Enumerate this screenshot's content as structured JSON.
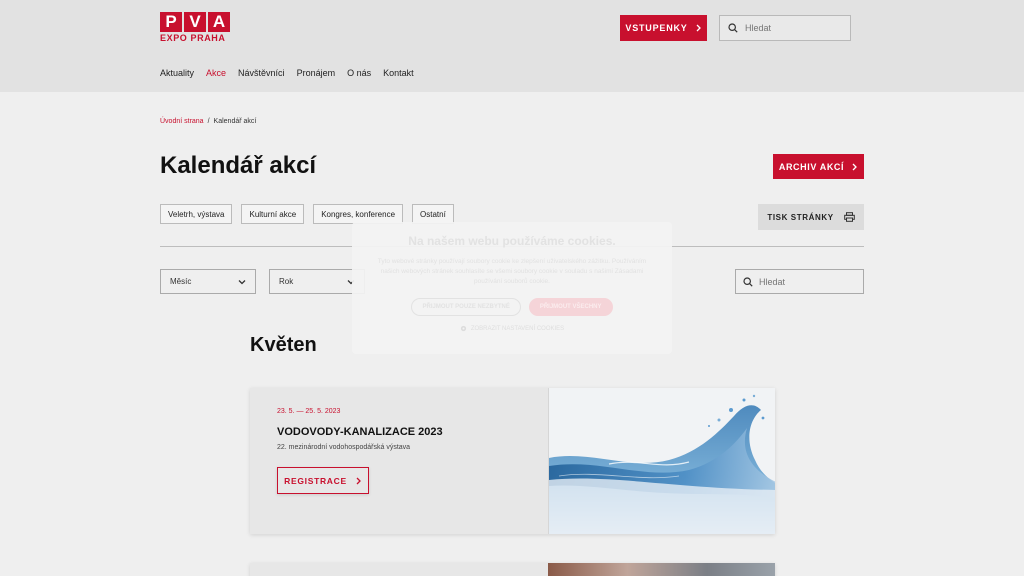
{
  "colors": {
    "brand": "#c8102e",
    "header_bg": "#e2e2e2",
    "page_bg": "#efefef"
  },
  "logo": {
    "letters": [
      "P",
      "V",
      "A"
    ],
    "subtitle": "EXPO PRAHA"
  },
  "header": {
    "tickets_label": "VSTUPENKY",
    "search_placeholder": "Hledat",
    "nav": [
      {
        "label": "Aktuality",
        "active": false
      },
      {
        "label": "Akce",
        "active": true
      },
      {
        "label": "Návštěvníci",
        "active": false
      },
      {
        "label": "Pronájem",
        "active": false
      },
      {
        "label": "O nás",
        "active": false
      },
      {
        "label": "Kontakt",
        "active": false
      }
    ]
  },
  "breadcrumb": {
    "home": "Úvodní strana",
    "separator": "/",
    "current": "Kalendář akcí"
  },
  "page": {
    "title": "Kalendář akcí",
    "archive_label": "ARCHIV AKCÍ",
    "print_label": "TISK STRÁNKY",
    "filters": [
      "Veletrh, výstava",
      "Kulturní akce",
      "Kongres, konference",
      "Ostatní"
    ],
    "month_select": "Měsíc",
    "year_select": "Rok",
    "search_placeholder": "Hledat",
    "month_heading": "Květen"
  },
  "events": [
    {
      "date": "23. 5. — 25. 5. 2023",
      "title": "VODOVODY-KANALIZACE 2023",
      "description": "22. mezinárodní vodohospodářská výstava",
      "register_label": "REGISTRACE"
    }
  ],
  "cookie": {
    "title": "Na našem webu používáme cookies.",
    "text": "Tyto webové stránky používají soubory cookie ke zlepšení uživatelského zážitku. Používáním našich webových stránek souhlasíte se všemi soubory cookie v souladu s našimi Zásadami používání souborů cookie.",
    "necessary_label": "PŘIJMOUT POUZE NEZBYTNÉ",
    "all_label": "PŘIJMOUT VŠECHNY",
    "settings_label": "ZOBRAZIT NASTAVENÍ COOKIES"
  },
  "icons": {
    "chevron": "chevron-right-icon",
    "search": "search-icon",
    "print": "printer-icon",
    "dropdown": "chevron-down-icon",
    "gear": "gear-icon"
  }
}
